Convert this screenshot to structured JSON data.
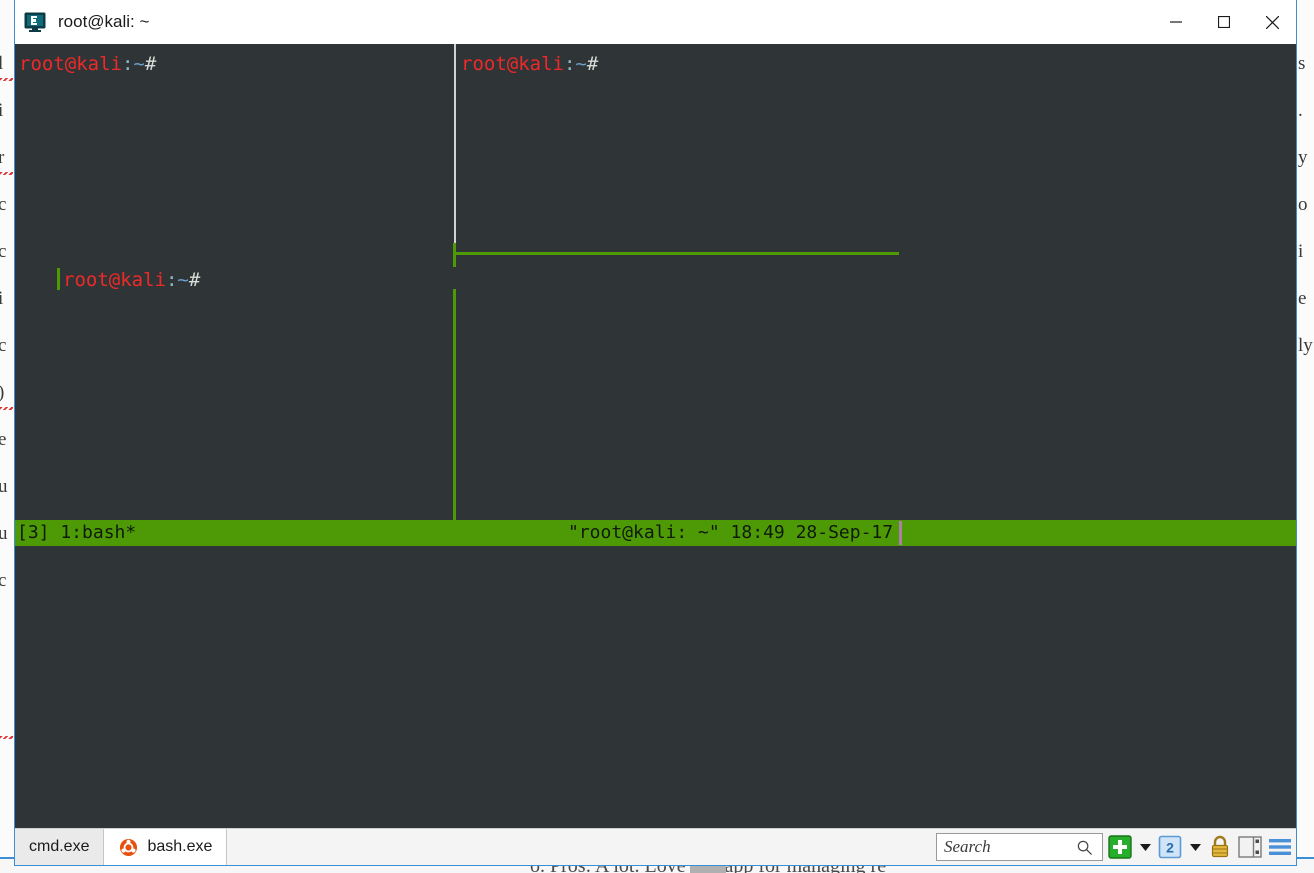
{
  "backdrop": {
    "left_column_chars": [
      "l",
      "i",
      "r",
      "c",
      "c",
      "i",
      "c",
      ")",
      "e",
      "u",
      "u",
      "c"
    ],
    "right_column_chars": [
      "s",
      ".",
      "y",
      "o",
      "i",
      "e",
      "ly"
    ],
    "bottom_text": "o. Pros: A lot. Love this app for managing re"
  },
  "window": {
    "title": "root@kali: ~",
    "icon": "conemu-monitor-icon",
    "controls": {
      "minimize_label": "Minimize",
      "maximize_label": "Maximize",
      "close_label": "Close"
    }
  },
  "terminal": {
    "background": "#2f3436",
    "prompt_user_host": "root@kali",
    "prompt_colon": ":",
    "prompt_path": "~",
    "prompt_sigil": "#",
    "panes": [
      {
        "id": "pane-left-top",
        "prompt": "root@kali:~#"
      },
      {
        "id": "pane-left-bottom",
        "prompt": "root@kali:~#",
        "has_cursor": true
      },
      {
        "id": "pane-right-top",
        "prompt": "root@kali:~#"
      },
      {
        "id": "pane-right-bottom",
        "prompt": ""
      }
    ],
    "divider_color_active": "#4e9a06",
    "divider_color_inactive": "#d0d3d0"
  },
  "tmux_status": {
    "left": "[3] 1:bash*",
    "center": "\"root@kali: ~\" 18:49 28-Sep-17",
    "session_id": "[3]",
    "window_list": "1:bash*",
    "window_title": "\"root@kali: ~\"",
    "time": "18:49",
    "date": "28-Sep-17",
    "background": "#4e9a06",
    "foreground": "#0f1a0a"
  },
  "bottombar": {
    "tabs": [
      {
        "label": "cmd.exe",
        "icon": null,
        "active": false
      },
      {
        "label": "bash.exe",
        "icon": "ubuntu-icon",
        "active": true
      }
    ],
    "search": {
      "placeholder": "Search",
      "value": "",
      "icon": "magnifier-icon"
    },
    "buttons": [
      {
        "name": "new-console-button",
        "icon": "green-plus-icon",
        "label": ""
      },
      {
        "name": "new-console-dropdown",
        "icon": "chevron-down-icon",
        "label": ""
      },
      {
        "name": "console-count-button",
        "icon": "number-badge-icon",
        "label": "2"
      },
      {
        "name": "console-list-dropdown",
        "icon": "chevron-down-icon",
        "label": ""
      },
      {
        "name": "lock-button",
        "icon": "lock-icon",
        "label": ""
      },
      {
        "name": "split-pane-button",
        "icon": "split-pane-icon",
        "label": ""
      },
      {
        "name": "main-menu-button",
        "icon": "hamburger-menu-icon",
        "label": ""
      }
    ]
  }
}
